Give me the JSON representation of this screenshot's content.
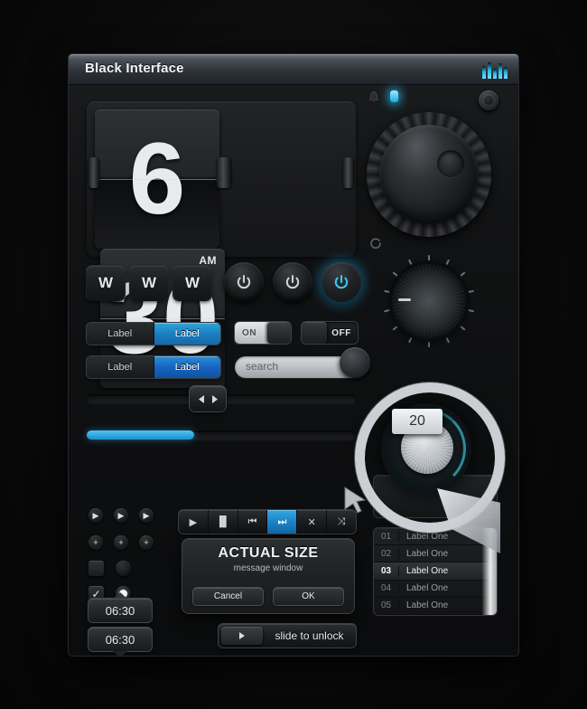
{
  "window": {
    "title": "Black Interface",
    "eq_icon": "equalizer-icon"
  },
  "clock": {
    "hours": "6",
    "minutes": "30",
    "meridiem": "AM"
  },
  "indicators": {
    "bell_icon": "bell-icon",
    "led_icon": "led-indicator",
    "mini_button_icon": "round-button-icon",
    "c_icon": "power-cycle-icon"
  },
  "wbuttons": [
    {
      "label": "W"
    },
    {
      "label": "W"
    },
    {
      "label": "W"
    }
  ],
  "power_buttons": [
    {
      "name": "power-button-1",
      "active": false
    },
    {
      "name": "power-button-2",
      "active": false
    },
    {
      "name": "power-button-3",
      "active": true
    }
  ],
  "segmented": [
    {
      "left_label": "Label",
      "right_label": "Label",
      "active": "right"
    },
    {
      "left_label": "Label",
      "right_label": "Label",
      "active": "right"
    }
  ],
  "toggles": {
    "on_label": "ON",
    "off_label": "OFF"
  },
  "search": {
    "placeholder": "search",
    "value": ""
  },
  "sliders": {
    "track_value": 0,
    "progress_percent": 40
  },
  "media": [
    {
      "icon": "play-icon",
      "glyph": "▶",
      "active": false
    },
    {
      "icon": "pause-icon",
      "glyph": "▐▌",
      "active": false
    },
    {
      "icon": "previous-icon",
      "glyph": "⏮",
      "active": false
    },
    {
      "icon": "next-icon",
      "glyph": "⏭",
      "active": true
    },
    {
      "icon": "close-icon",
      "glyph": "✕",
      "active": false
    },
    {
      "icon": "shuffle-icon",
      "glyph": "⤨",
      "active": false
    }
  ],
  "mini_controls": {
    "arrow_glyph": "▶",
    "plus_glyph": "+",
    "check_glyph": "✓"
  },
  "dialog": {
    "title": "ACTUAL SIZE",
    "subtitle": "message window",
    "cancel_label": "Cancel",
    "ok_label": "OK"
  },
  "list": {
    "rows": [
      {
        "index": "01",
        "label": "Label One",
        "selected": false
      },
      {
        "index": "02",
        "label": "Label One",
        "selected": false
      },
      {
        "index": "03",
        "label": "Label One",
        "selected": true
      },
      {
        "index": "04",
        "label": "Label One",
        "selected": false
      },
      {
        "index": "05",
        "label": "Label One",
        "selected": false
      }
    ]
  },
  "magnifier": {
    "value_badge": "20"
  },
  "time_boxes": [
    {
      "value": "06:30"
    },
    {
      "value": "06:30"
    }
  ],
  "unlock": {
    "label": "slide to unlock",
    "handle_icon": "arrow-right-icon"
  },
  "pager": {
    "dots": [
      {
        "active": true
      },
      {
        "active": false
      },
      {
        "active": false
      }
    ]
  },
  "colors": {
    "accent_blue": "#1b7fc4",
    "led_cyan": "#18aee0",
    "panel_dark": "#121314",
    "titlebar_top": "#6e757d"
  }
}
